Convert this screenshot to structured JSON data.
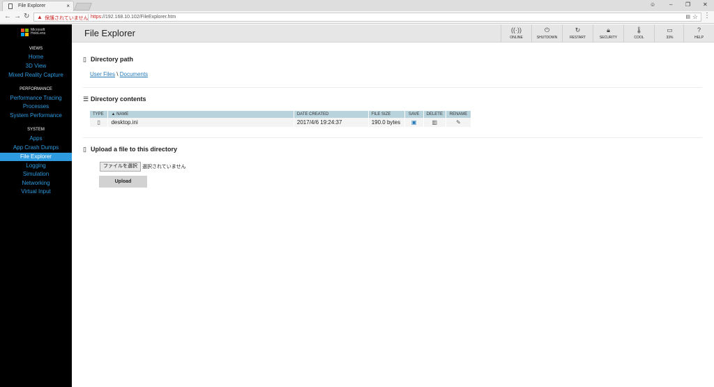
{
  "browser": {
    "tab_title": "File Explorer",
    "tab_close": "×",
    "security_text": "保護されていません",
    "url_scheme": "https",
    "url_rest": "://192.168.10.102/FileExplorer.htm",
    "back": "←",
    "forward": "→",
    "reload": "↻",
    "star": "☆",
    "menu": "⋮",
    "minimize": "–",
    "restore": "❐",
    "close": "✕"
  },
  "sidebar": {
    "brand_line1": "Microsoft",
    "brand_line2": "HoloLens",
    "sections": [
      {
        "title": "VIEWS",
        "items": [
          "Home",
          "3D View",
          "Mixed Reality Capture"
        ]
      },
      {
        "title": "PERFORMANCE",
        "items": [
          "Performance Tracing",
          "Processes",
          "System Performance"
        ]
      },
      {
        "title": "SYSTEM",
        "items": [
          "Apps",
          "App Crash Dumps",
          "File Explorer",
          "Logging",
          "Simulation",
          "Networking",
          "Virtual Input"
        ]
      }
    ],
    "active_item": "File Explorer"
  },
  "header": {
    "title": "File Explorer",
    "buttons": [
      {
        "icon": "wifi-icon",
        "glyph": "((·))",
        "label": "ONLINE"
      },
      {
        "icon": "power-icon",
        "glyph": "⏻",
        "label": "SHUTDOWN"
      },
      {
        "icon": "restart-icon",
        "glyph": "↻",
        "label": "RESTART"
      },
      {
        "icon": "lock-icon",
        "glyph": "🔒︎",
        "label": "SECURITY"
      },
      {
        "icon": "thermometer-icon",
        "glyph": "🌡︎",
        "label": "COOL"
      },
      {
        "icon": "battery-icon",
        "glyph": "▭",
        "label": "33%"
      },
      {
        "icon": "help-icon",
        "glyph": "?",
        "label": "HELP"
      }
    ]
  },
  "main": {
    "directory_path": {
      "title": "Directory path",
      "crumbs": [
        "User Files",
        "Documents"
      ],
      "separator": "\\"
    },
    "directory_contents": {
      "title": "Directory contents",
      "columns": [
        "TYPE",
        "▲ NAME",
        "DATE CREATED",
        "FILE SIZE",
        "SAVE",
        "DELETE",
        "RENAME"
      ],
      "rows": [
        {
          "name": "desktop.ini",
          "date": "2017/4/6 19:24:37",
          "size": "190.0 bytes"
        }
      ]
    },
    "upload": {
      "title": "Upload a file to this directory",
      "choose_label": "ファイルを選択",
      "no_file_text": "選択されていません",
      "upload_label": "Upload"
    }
  }
}
